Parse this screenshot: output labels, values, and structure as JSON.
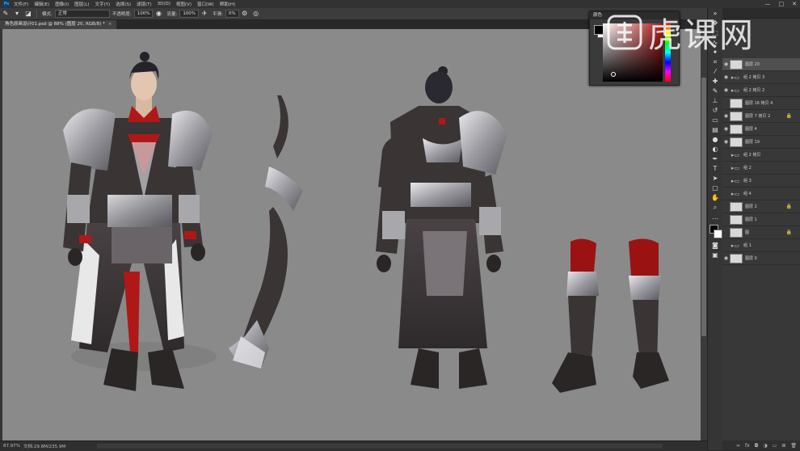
{
  "app": {
    "logo": "Ps"
  },
  "menu": {
    "items": [
      "文件(F)",
      "编辑(E)",
      "图像(I)",
      "图层(L)",
      "文字(Y)",
      "选择(S)",
      "滤镜(T)",
      "3D(D)",
      "视图(V)",
      "窗口(W)",
      "帮助(H)"
    ]
  },
  "window_controls": {
    "minimize": "—",
    "maximize": "□",
    "close": "✕"
  },
  "options_bar": {
    "mode_label": "模式:",
    "mode_value": "正常",
    "opacity_label": "不透明度:",
    "opacity_value": "100%",
    "flow_label": "流量:",
    "flow_value": "100%",
    "smoothing_label": "平滑:",
    "smoothing_value": "0%"
  },
  "document_tab": {
    "title": "角色原画设计01.psd @ 88% (图层 20, RGB/8) *",
    "close": "×"
  },
  "status_bar": {
    "zoom": "87.97%",
    "doc_size": "文档:29.8M/235.9M"
  },
  "color_panel": {
    "title": "颜色",
    "foreground": "#000000",
    "background": "#ffffff"
  },
  "layers": [
    {
      "name": "图层 20",
      "selected": true,
      "kind": "layer"
    },
    {
      "name": "组 2 拷贝 3",
      "kind": "group"
    },
    {
      "name": "组 2 拷贝 2",
      "kind": "group"
    },
    {
      "name": "图层 16 拷贝 4",
      "kind": "layer"
    },
    {
      "name": "图层 7 拷贝 2",
      "kind": "layer",
      "lock": true
    },
    {
      "name": "图层 4",
      "kind": "layer"
    },
    {
      "name": "图层 19",
      "kind": "layer"
    },
    {
      "name": "组 2 拷贝",
      "kind": "group"
    },
    {
      "name": "组 2",
      "kind": "group"
    },
    {
      "name": "组 3",
      "kind": "group"
    },
    {
      "name": "组 4",
      "kind": "group"
    },
    {
      "name": "图层 2",
      "kind": "layer",
      "lock": true
    },
    {
      "name": "图层 1",
      "kind": "layer"
    },
    {
      "name": "图",
      "kind": "layer",
      "lock": true
    },
    {
      "name": "组 1",
      "kind": "group"
    },
    {
      "name": "图层 0",
      "kind": "layer"
    }
  ],
  "watermark": {
    "text": "虎课网"
  },
  "colors": {
    "canvas": "#8a8a8a",
    "accent_red": "#b01818",
    "armor_dark": "#3a3434",
    "silver": "#c8c8cc"
  }
}
